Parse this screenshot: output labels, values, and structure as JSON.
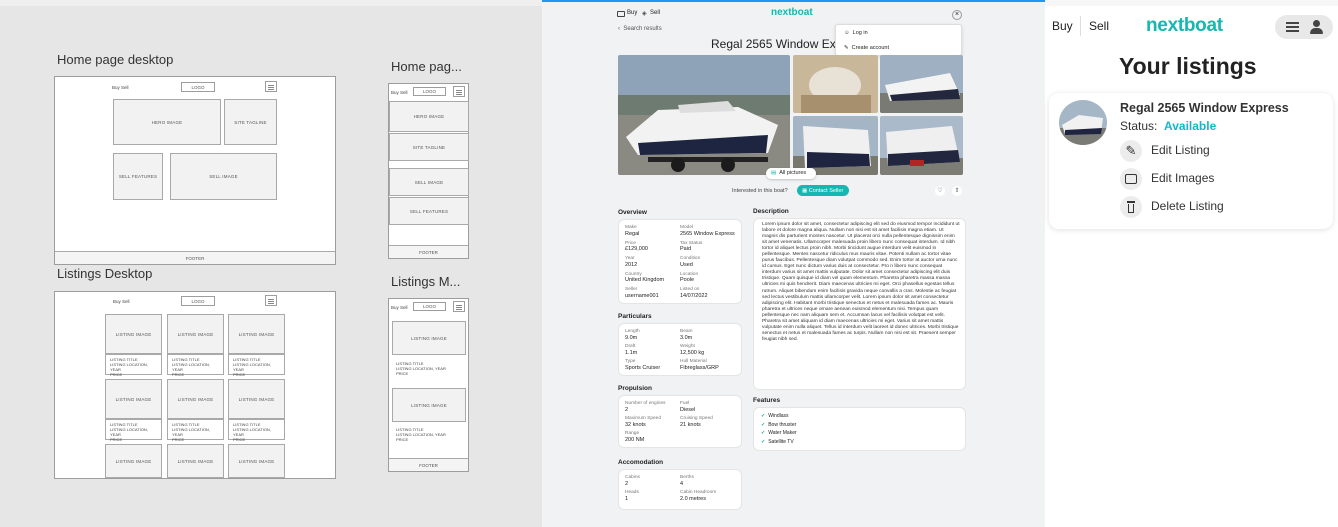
{
  "wireframes": {
    "home_desktop": {
      "label": "Home page desktop",
      "nav": "Buy Sell",
      "logo": "LOGO",
      "hero": "HERO IMAGE",
      "tagline": "SITE TAGLINE",
      "sell_features": "SELL FEATURES",
      "sell_image": "SELL IMAGE",
      "footer": "FOOTER"
    },
    "home_mobile": {
      "label": "Home pag...",
      "nav": "Buy Sell",
      "logo": "LOGO",
      "hero": "HERO IMAGE",
      "tagline": "SITE TAGLINE",
      "sell_image": "SELL IMAGE",
      "sell_features": "SELL FEATURES",
      "footer": "FOOTER"
    },
    "listings_desktop": {
      "label": "Listings Desktop",
      "nav": "Buy Sell",
      "logo": "LOGO",
      "card_image": "LISTING IMAGE",
      "card_title": "LISTING TITLE",
      "card_location": "LISTING LOCATION, YEAR",
      "card_price": "PRICE"
    },
    "listings_mobile": {
      "label": "Listings M...",
      "nav": "Buy Sell",
      "logo": "LOGO",
      "card_image": "LISTING IMAGE",
      "card_title": "LISTING TITLE",
      "card_location": "LISTING LOCATION, YEAR",
      "card_price": "PRICE",
      "footer": "FOOTER"
    }
  },
  "detail": {
    "nav_buy": "Buy",
    "nav_sell": "Sell",
    "brand": "nextboat",
    "back": "Search results",
    "title": "Regal 2565 Window Expr",
    "dropdown": {
      "login": "Log in",
      "create": "Create account"
    },
    "all_pictures": "All pictures",
    "interested": "Interested in this boat?",
    "contact": "Contact Seller",
    "overview": {
      "title": "Overview",
      "left": [
        {
          "label": "Make",
          "value": "Regal"
        },
        {
          "label": "Price",
          "value": "£129,000"
        },
        {
          "label": "Year",
          "value": "2012"
        },
        {
          "label": "Country",
          "value": "United Kingdom"
        },
        {
          "label": "Seller",
          "value": "username001"
        }
      ],
      "right": [
        {
          "label": "Model",
          "value": "2565 Window Express"
        },
        {
          "label": "Tax Status",
          "value": "Paid"
        },
        {
          "label": "Condition",
          "value": "Used"
        },
        {
          "label": "Location",
          "value": "Poole"
        },
        {
          "label": "Listed on",
          "value": "14/07/2022"
        }
      ]
    },
    "particulars": {
      "title": "Particulars",
      "left": [
        {
          "label": "Length",
          "value": "9.0m"
        },
        {
          "label": "Draft",
          "value": "1.1m"
        },
        {
          "label": "Type",
          "value": "Sports Cruiser"
        }
      ],
      "right": [
        {
          "label": "Beam",
          "value": "3.0m"
        },
        {
          "label": "Weight",
          "value": "12,500 kg"
        },
        {
          "label": "Hull Material",
          "value": "Fibreglass/GRP"
        }
      ]
    },
    "propulsion": {
      "title": "Propulsion",
      "left": [
        {
          "label": "Number of engines",
          "value": "2"
        },
        {
          "label": "Maximum Speed",
          "value": "32 knots"
        },
        {
          "label": "Range",
          "value": "200 NM"
        }
      ],
      "right": [
        {
          "label": "Fuel",
          "value": "Diesel"
        },
        {
          "label": "Cruising Speed",
          "value": "21 knots"
        }
      ]
    },
    "accomodation": {
      "title": "Accomodation",
      "left": [
        {
          "label": "Cabins",
          "value": "2"
        },
        {
          "label": "Heads",
          "value": "1"
        }
      ],
      "right": [
        {
          "label": "Berths",
          "value": "4"
        },
        {
          "label": "Cabin Headroom",
          "value": "2.0 metres"
        }
      ]
    },
    "description": {
      "title": "Description",
      "text": "Lorem ipsum dolor sit amet, consectetur adipiscing elit sed do eiusmod tempor incididunt ut labore et dolore magna aliqua. Nullam non nisi est sit amet facilisis magna etiam. Ut magnis dis parturient montes nascetur. Ut placerat orci nulla pellentesque dignissim enim sit amet venenatis. Ullamcorper malesuada proin libero nunc consequat interdum. Id nibh tortor id aliquet lectus proin nibh. Morbi tincidunt augue interdum velit euismod in pellentesque. Mentes nascetur ridiculus mus mauris vitae. Potenti nullam ac tortor vitae purus faucibus. Pellentesque diam volutpat commodo sed. Enim tortor at auctor urna nunc id cursus. Eget nunc dictum varius duis at consectetur. Pro n libero nunc consequat interdum varius sit amet mattis vulputate. Dolor sit amet consectetur adipiscing elit duis tristique. Quam quisque id diam vel quam elementum. Pharetra pharetra massa massa ultricies mi quis hendrerit. Diam maecenas ultricies mi eget. Orci phasellus egestas tellus rutrum. Aliquet bibendum enim facilisis gravida neque convallis a cras. Molestie ac feugiat sed lectus vestibulum mattis ullamcorper velit. Lorem ipsum dolor sit amet consectetur adipiscing elit. Habitant morbi tristique senectus et netus et malesuada fames ac. Mauris pharetra et ultrices neque ornare aenean euismod elementum nisi. Tempus quam pellentesque nec nam aliquam sem et. Accumsan lacus vel facilisis volutpat est velit. Pharetra sit amet aliquam id diam maecenas ultricies mi eget. Varius sit amet mattis vulputate enim nulla aliquet. Tellus id interdum velit laoreet id donec ultrices. Morbi tristique senectus et netus et malesuada fames ac turpis. Nullam non nisi est sit. Praesent semper feugiat nibh sed."
    },
    "features": {
      "title": "Features",
      "items": [
        "Windlass",
        "Bow thruster",
        "Water Maker",
        "Satellite TV"
      ]
    }
  },
  "mobile": {
    "nav_buy": "Buy",
    "nav_sell": "Sell",
    "brand": "nextboat",
    "heading": "Your listings",
    "listing_title": "Regal 2565 Window Express",
    "status_label": "Status:",
    "status_value": "Available",
    "actions": {
      "edit": "Edit Listing",
      "images": "Edit Images",
      "delete": "Delete Listing"
    },
    "colors": {
      "brand": "#15b8b0",
      "status": "#14b7c9"
    }
  }
}
